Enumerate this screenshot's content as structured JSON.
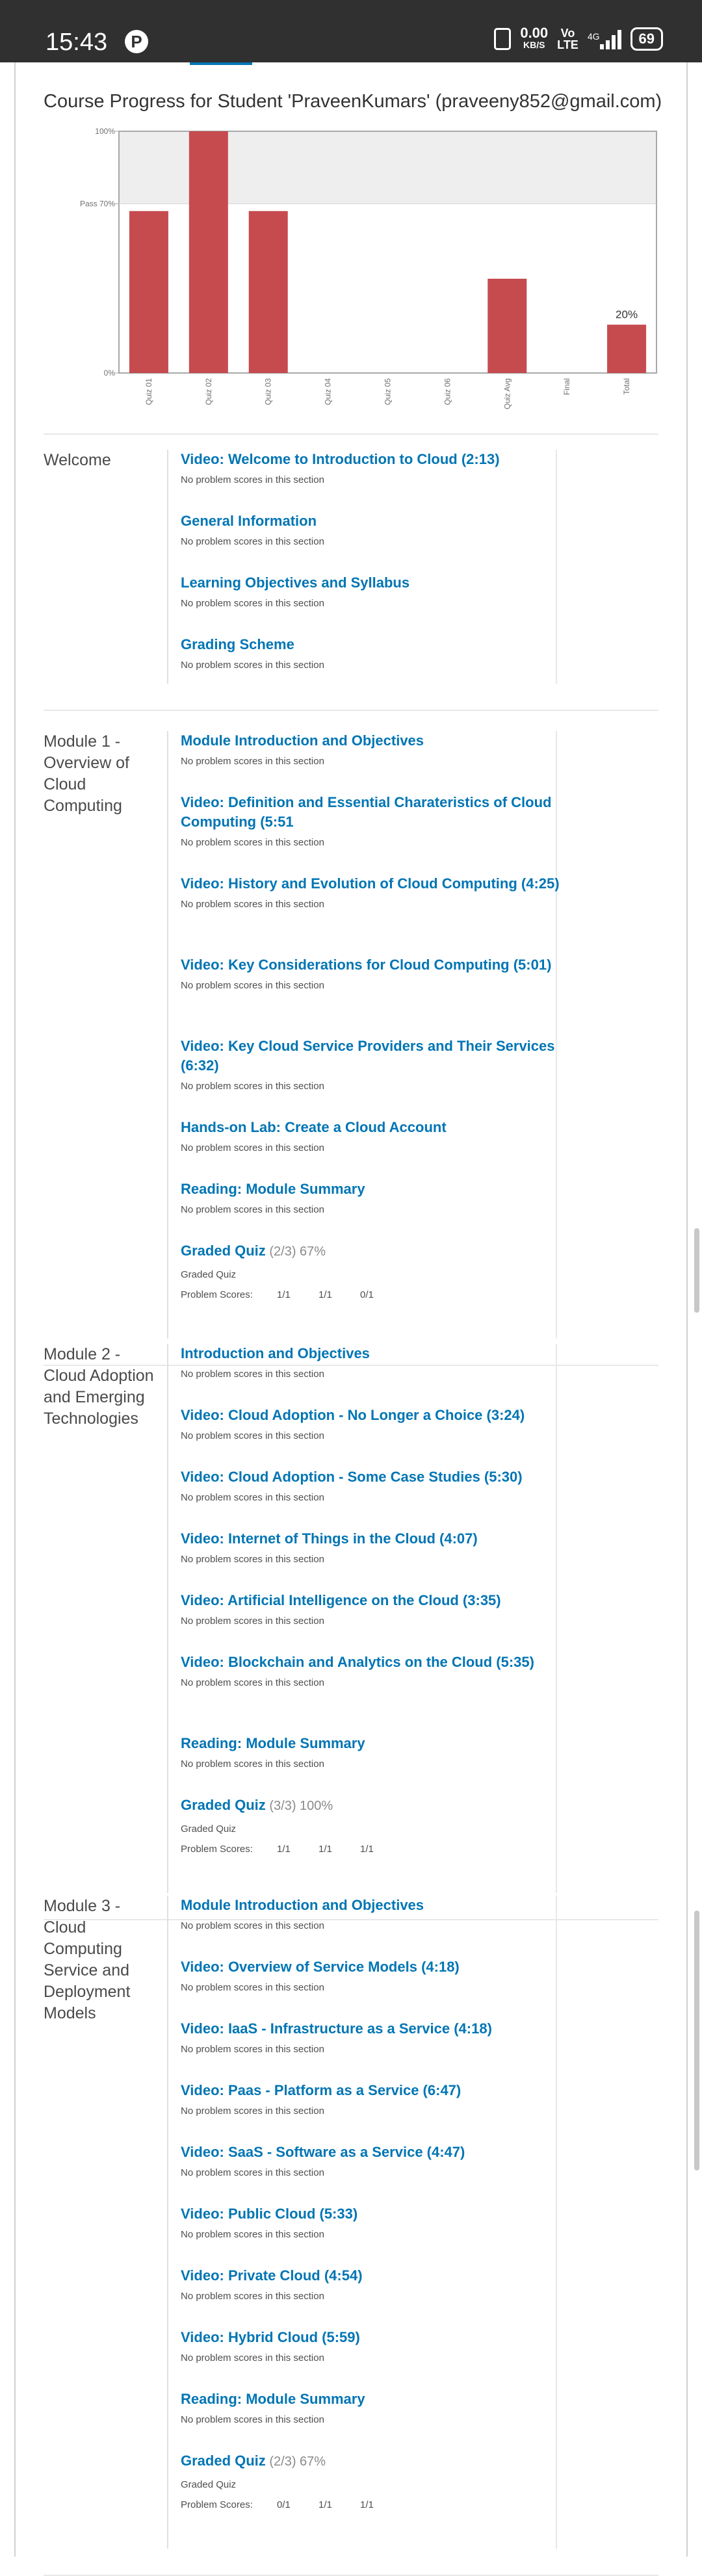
{
  "status_bar": {
    "time": "15:43",
    "speed_value": "0.00",
    "speed_unit": "KB/S",
    "volte_top": "Vo",
    "volte_bottom": "LTE",
    "network": "4G",
    "battery": "69"
  },
  "page_title": "Course Progress for Student 'PraveenKumars' (praveeny852@gmail.com)",
  "chart_data": {
    "type": "bar",
    "categories": [
      "Quiz 01",
      "Quiz 02",
      "Quiz 03",
      "Quiz 04",
      "Quiz 05",
      "Quiz 06",
      "Quiz Avg",
      "Final",
      "Total"
    ],
    "values": [
      67,
      100,
      67,
      0,
      0,
      0,
      39,
      0,
      20
    ],
    "ylim": [
      0,
      100
    ],
    "y_ticks": [
      {
        "label": "0%",
        "value": 0
      },
      {
        "label": "Pass 70%",
        "value": 70
      },
      {
        "label": "100%",
        "value": 100
      }
    ],
    "pass_value": 70,
    "data_labels": [
      {
        "category": "Total",
        "label": "20%"
      }
    ],
    "bar_color": "#c64b4f",
    "pass_band_color": "#eeeeee"
  },
  "sections": [
    {
      "name": "Welcome",
      "items": [
        {
          "title": "Video: Welcome to Introduction to Cloud (2:13)",
          "note": "No problem scores in this section"
        },
        {
          "title": "General Information",
          "note": "No problem scores in this section"
        },
        {
          "title": "Learning Objectives and Syllabus",
          "note": "No problem scores in this section"
        },
        {
          "title": "Grading Scheme",
          "note": "No problem scores in this section"
        }
      ]
    },
    {
      "name": "Module 1 - Overview of Cloud Computing",
      "items": [
        {
          "title": "Module Introduction and Objectives",
          "note": "No problem scores in this section"
        },
        {
          "title": "Video: Definition and Essential Charateristics of Cloud Computing (5:51",
          "note": "No problem scores in this section"
        },
        {
          "title": "Video: History and Evolution of Cloud Computing (4:25)",
          "note": "No problem scores in this section"
        },
        {
          "title": "Video: Key Considerations for Cloud Computing (5:01)",
          "note": "No problem scores in this section"
        },
        {
          "title": "Video: Key Cloud Service Providers and Their Services (6:32)",
          "note": "No problem scores in this section"
        },
        {
          "title": "Hands-on Lab: Create a Cloud Account",
          "note": "No problem scores in this section"
        },
        {
          "title": "Reading: Module Summary",
          "note": "No problem scores in this section"
        },
        {
          "title": "Graded Quiz",
          "score": "(2/3) 67%",
          "graded": "Graded Quiz",
          "scores_label": "Problem Scores:",
          "scores": [
            "1/1",
            "1/1",
            "0/1"
          ]
        }
      ]
    },
    {
      "name": "Module 2 - Cloud Adoption and Emerging Technologies",
      "items": [
        {
          "title": "Introduction and Objectives",
          "note": "No problem scores in this section"
        },
        {
          "title": "Video: Cloud Adoption - No Longer a Choice (3:24)",
          "note": "No problem scores in this section"
        },
        {
          "title": "Video: Cloud Adoption - Some Case Studies (5:30)",
          "note": "No problem scores in this section"
        },
        {
          "title": "Video: Internet of Things in the Cloud (4:07)",
          "note": "No problem scores in this section"
        },
        {
          "title": "Video: Artificial Intelligence on the Cloud (3:35)",
          "note": "No problem scores in this section"
        },
        {
          "title": "Video: Blockchain and Analytics on the Cloud (5:35)",
          "note": "No problem scores in this section"
        },
        {
          "title": "Reading: Module Summary",
          "note": "No problem scores in this section"
        },
        {
          "title": "Graded Quiz",
          "score": "(3/3) 100%",
          "graded": "Graded Quiz",
          "scores_label": "Problem Scores:",
          "scores": [
            "1/1",
            "1/1",
            "1/1"
          ]
        }
      ]
    },
    {
      "name": "Module 3 - Cloud Computing Service and Deployment Models",
      "items": [
        {
          "title": "Module Introduction and Objectives",
          "note": "No problem scores in this section"
        },
        {
          "title": "Video: Overview of Service Models (4:18)",
          "note": "No problem scores in this section"
        },
        {
          "title": "Video: IaaS - Infrastructure as a Service (4:18)",
          "note": "No problem scores in this section"
        },
        {
          "title": "Video: Paas - Platform as a Service (6:47)",
          "note": "No problem scores in this section"
        },
        {
          "title": "Video: SaaS - Software as a Service (4:47)",
          "note": "No problem scores in this section"
        },
        {
          "title": "Video: Public Cloud (5:33)",
          "note": "No problem scores in this section"
        },
        {
          "title": "Video: Private Cloud (4:54)",
          "note": "No problem scores in this section"
        },
        {
          "title": "Video: Hybrid Cloud (5:59)",
          "note": "No problem scores in this section"
        },
        {
          "title": "Reading: Module Summary",
          "note": "No problem scores in this section"
        },
        {
          "title": "Graded Quiz",
          "score": "(2/3) 67%",
          "graded": "Graded Quiz",
          "scores_label": "Problem Scores:",
          "scores": [
            "0/1",
            "1/1",
            "1/1"
          ]
        }
      ]
    }
  ]
}
